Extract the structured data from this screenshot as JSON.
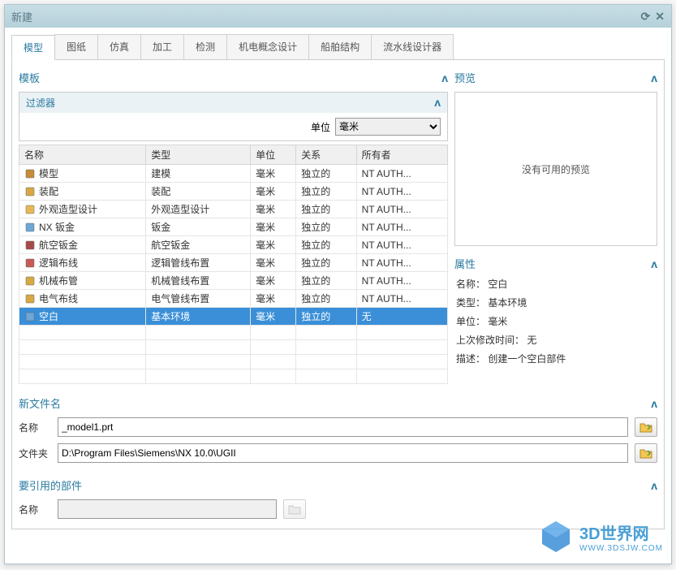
{
  "window": {
    "title": "新建"
  },
  "tabs": [
    "模型",
    "图纸",
    "仿真",
    "加工",
    "检测",
    "机电概念设计",
    "船舶结构",
    "流水线设计器"
  ],
  "active_tab": 0,
  "template": {
    "label": "模板",
    "filter_label": "过滤器",
    "unit_label": "单位",
    "unit_value": "毫米",
    "columns": [
      "名称",
      "类型",
      "单位",
      "关系",
      "所有者"
    ],
    "rows": [
      {
        "icon": "model",
        "name": "模型",
        "type": "建模",
        "unit": "毫米",
        "rel": "独立的",
        "owner": "NT AUTH..."
      },
      {
        "icon": "assembly",
        "name": "装配",
        "type": "装配",
        "unit": "毫米",
        "rel": "独立的",
        "owner": "NT AUTH..."
      },
      {
        "icon": "shape",
        "name": "外观造型设计",
        "type": "外观造型设计",
        "unit": "毫米",
        "rel": "独立的",
        "owner": "NT AUTH..."
      },
      {
        "icon": "nxsheet",
        "name": "NX 钣金",
        "type": "钣金",
        "unit": "毫米",
        "rel": "独立的",
        "owner": "NT AUTH..."
      },
      {
        "icon": "aero",
        "name": "航空钣金",
        "type": "航空钣金",
        "unit": "毫米",
        "rel": "独立的",
        "owner": "NT AUTH..."
      },
      {
        "icon": "logical",
        "name": "逻辑布线",
        "type": "逻辑管线布置",
        "unit": "毫米",
        "rel": "独立的",
        "owner": "NT AUTH..."
      },
      {
        "icon": "mech",
        "name": "机械布管",
        "type": "机械管线布置",
        "unit": "毫米",
        "rel": "独立的",
        "owner": "NT AUTH..."
      },
      {
        "icon": "elec",
        "name": "电气布线",
        "type": "电气管线布置",
        "unit": "毫米",
        "rel": "独立的",
        "owner": "NT AUTH..."
      },
      {
        "icon": "blank",
        "name": "空白",
        "type": "基本环境",
        "unit": "毫米",
        "rel": "独立的",
        "owner": "无",
        "selected": true
      }
    ]
  },
  "preview": {
    "label": "预览",
    "text": "没有可用的预览"
  },
  "props": {
    "label": "属性",
    "rows": [
      {
        "k": "名称：",
        "v": "空白"
      },
      {
        "k": "类型：",
        "v": "基本环境"
      },
      {
        "k": "单位：",
        "v": "毫米"
      },
      {
        "k": "上次修改时间：",
        "v": "无"
      },
      {
        "k": "描述：",
        "v": "创建一个空白部件"
      }
    ]
  },
  "newfile": {
    "label": "新文件名",
    "name_label": "名称",
    "name_value": "_model1.prt",
    "folder_label": "文件夹",
    "folder_value": "D:\\Program Files\\Siemens\\NX 10.0\\UGII"
  },
  "refpart": {
    "label": "要引用的部件",
    "name_label": "名称",
    "name_value": ""
  },
  "watermark": {
    "brand": "3D世界网",
    "url": "WWW.3DSJW.COM"
  }
}
